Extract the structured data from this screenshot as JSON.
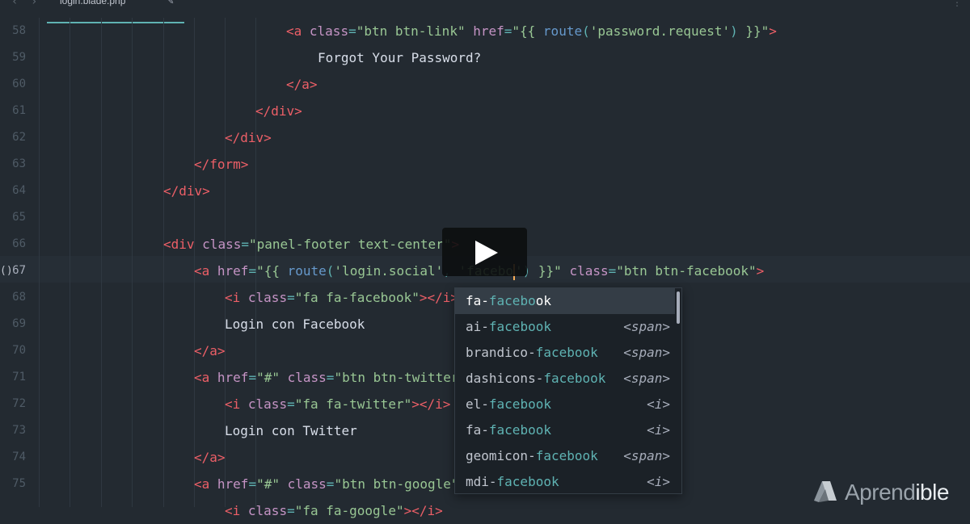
{
  "tab": {
    "filename": "login.blade.php"
  },
  "gutter": {
    "lines": [
      "58",
      "59",
      "60",
      "61",
      "62",
      "63",
      "64",
      "65",
      "66",
      "67",
      "68",
      "69",
      "70",
      "71",
      "72",
      "73",
      "74",
      "75"
    ],
    "active_index": 9,
    "fold_marker": "()"
  },
  "editor": {
    "lines": [
      [
        [
          "t",
          "tg",
          "<a "
        ],
        [
          "t",
          "at",
          "class"
        ],
        [
          "t",
          "pn",
          "="
        ],
        [
          "t",
          "st",
          "\"btn btn-link\""
        ],
        [
          "t",
          "tx",
          " "
        ],
        [
          "t",
          "at",
          "href"
        ],
        [
          "t",
          "pn",
          "="
        ],
        [
          "t",
          "st",
          "\"{{ "
        ],
        [
          "t",
          "fn",
          "route"
        ],
        [
          "t",
          "pn",
          "("
        ],
        [
          "t",
          "st",
          "'password.request'"
        ],
        [
          "t",
          "pn",
          ")"
        ],
        [
          "t",
          "st",
          " }}\""
        ],
        [
          "t",
          "tg",
          ">"
        ]
      ],
      [
        [
          "t",
          "tx",
          "Forgot Your Password?"
        ]
      ],
      [
        [
          "t",
          "tg",
          "</a>"
        ]
      ],
      [
        [
          "t",
          "tg",
          "</div>"
        ]
      ],
      [
        [
          "t",
          "tg",
          "</div>"
        ]
      ],
      [
        [
          "t",
          "tg",
          "</form>"
        ]
      ],
      [
        [
          "t",
          "tg",
          "</div>"
        ]
      ],
      [],
      [
        [
          "t",
          "tg",
          "<div "
        ],
        [
          "t",
          "at",
          "class"
        ],
        [
          "t",
          "pn",
          "="
        ],
        [
          "t",
          "st",
          "\"panel-footer text-center\""
        ],
        [
          "t",
          "tg",
          ">"
        ]
      ],
      [
        [
          "t",
          "tg",
          "<a "
        ],
        [
          "t",
          "at",
          "href"
        ],
        [
          "t",
          "pn",
          "="
        ],
        [
          "t",
          "st",
          "\"{{ "
        ],
        [
          "t",
          "fn",
          "route"
        ],
        [
          "t",
          "pn",
          "("
        ],
        [
          "t",
          "st",
          "'login.social'"
        ],
        [
          "t",
          "pn",
          ", "
        ],
        [
          "t",
          "st",
          "'facebo"
        ],
        [
          "cursor"
        ],
        [
          "t",
          "st",
          "'"
        ],
        [
          "t",
          "pn",
          ")"
        ],
        [
          "t",
          "st",
          " }}\""
        ],
        [
          "t",
          "tx",
          " "
        ],
        [
          "t",
          "at",
          "class"
        ],
        [
          "t",
          "pn",
          "="
        ],
        [
          "t",
          "st",
          "\"btn btn-facebook\""
        ],
        [
          "t",
          "tg",
          ">"
        ]
      ],
      [
        [
          "t",
          "tg",
          "<i "
        ],
        [
          "t",
          "at",
          "class"
        ],
        [
          "t",
          "pn",
          "="
        ],
        [
          "t",
          "st",
          "\"fa fa-facebook\""
        ],
        [
          "t",
          "tg",
          "></i>"
        ]
      ],
      [
        [
          "t",
          "tx",
          "Login con Facebook"
        ]
      ],
      [
        [
          "t",
          "tg",
          "</a>"
        ]
      ],
      [
        [
          "t",
          "tg",
          "<a "
        ],
        [
          "t",
          "at",
          "href"
        ],
        [
          "t",
          "pn",
          "="
        ],
        [
          "t",
          "st",
          "\"#\""
        ],
        [
          "t",
          "tx",
          " "
        ],
        [
          "t",
          "at",
          "class"
        ],
        [
          "t",
          "pn",
          "="
        ],
        [
          "t",
          "st",
          "\"btn btn-twitter"
        ]
      ],
      [
        [
          "t",
          "tg",
          "<i "
        ],
        [
          "t",
          "at",
          "class"
        ],
        [
          "t",
          "pn",
          "="
        ],
        [
          "t",
          "st",
          "\"fa fa-twitter\""
        ],
        [
          "t",
          "tg",
          "></i>"
        ]
      ],
      [
        [
          "t",
          "tx",
          "Login con Twitter"
        ]
      ],
      [
        [
          "t",
          "tg",
          "</a>"
        ]
      ],
      [
        [
          "t",
          "tg",
          "<a "
        ],
        [
          "t",
          "at",
          "href"
        ],
        [
          "t",
          "pn",
          "="
        ],
        [
          "t",
          "st",
          "\"#\""
        ],
        [
          "t",
          "tx",
          " "
        ],
        [
          "t",
          "at",
          "class"
        ],
        [
          "t",
          "pn",
          "="
        ],
        [
          "t",
          "st",
          "\"btn btn-google\""
        ]
      ],
      [
        [
          "t",
          "tg",
          "<i "
        ],
        [
          "t",
          "at",
          "class"
        ],
        [
          "t",
          "pn",
          "="
        ],
        [
          "t",
          "st",
          "\"fa fa-google\""
        ],
        [
          "t",
          "tg",
          "></i>"
        ]
      ]
    ]
  },
  "autocomplete": {
    "query": "facebook",
    "items": [
      {
        "prefix": "fa-",
        "match": "facebo",
        "rest": "ok",
        "kind": ""
      },
      {
        "prefix": "ai-",
        "match": "facebook",
        "rest": "",
        "kind": "<span>"
      },
      {
        "prefix": "brandico-",
        "match": "facebook",
        "rest": "",
        "kind": "<span>"
      },
      {
        "prefix": "dashicons-",
        "match": "facebook",
        "rest": "",
        "kind": "<span>"
      },
      {
        "prefix": "el-",
        "match": "facebook",
        "rest": "",
        "kind": "<i>"
      },
      {
        "prefix": "fa-",
        "match": "facebook",
        "rest": "",
        "kind": "<i>"
      },
      {
        "prefix": "geomicon-",
        "match": "facebook",
        "rest": "",
        "kind": "<span>"
      },
      {
        "prefix": "mdi-",
        "match": "facebook",
        "rest": "",
        "kind": "<i>"
      }
    ],
    "selected_index": 0
  },
  "video": {
    "play_icon": "play-icon"
  },
  "watermark": {
    "brand_light": "Apre",
    "brand_bold": "nd",
    "brand_rest": "ible"
  },
  "colors": {
    "background": "#232a31",
    "tag": "#ec5f67",
    "attr": "#c594c5",
    "string": "#99c794",
    "accent": "#5fb3b3"
  }
}
